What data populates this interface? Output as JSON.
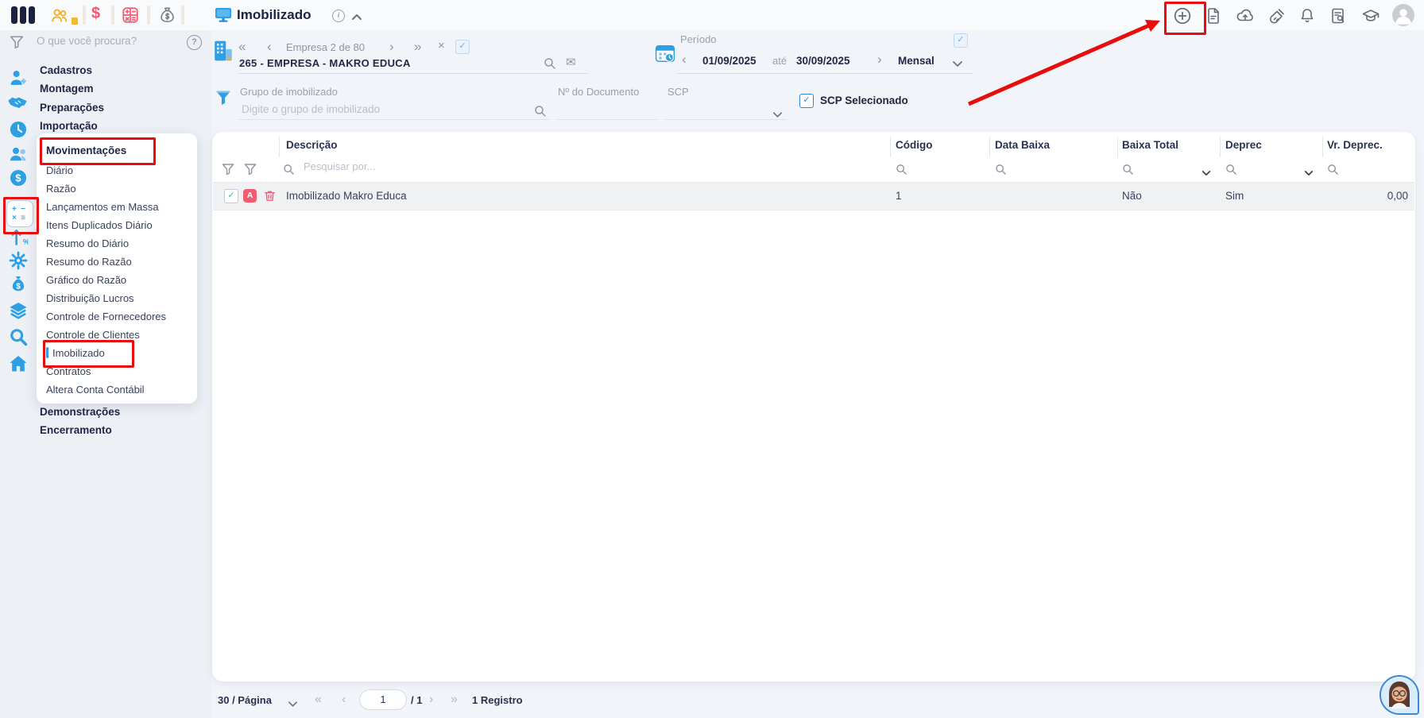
{
  "colors": {
    "accent_blue": "#2D9FE3",
    "navy": "#1E2547",
    "annotation_red": "#E80C0C",
    "badge_red": "#F25C72",
    "check_green": "#3DBD8F",
    "icon_gray": "#656C77",
    "sidebar_bg": "#EDF1F6",
    "card_bg": "#FFFFFF",
    "row_bg": "#F0F1F3"
  },
  "icons": {
    "double_chevron_left": "«",
    "chevron_left": "‹",
    "chevron_right": "›",
    "double_chevron_right": "»",
    "close": "×",
    "question_mark": "?",
    "info": "i",
    "check": "✓",
    "envelope": "✉",
    "dollar": "$",
    "chevron_up": "⌃"
  },
  "topbar": {
    "page_title": "Imobilizado",
    "quick_icons": [
      "people",
      "dollar",
      "calculator",
      "money-bag"
    ],
    "right_icons": [
      "add",
      "document",
      "upload",
      "clean",
      "notifications",
      "audit-log",
      "training",
      "avatar"
    ]
  },
  "sidebar": {
    "search_placeholder": "O que você procura?",
    "rail_icons": [
      "person-gear",
      "handshake",
      "clock",
      "people",
      "dollar",
      "calculator",
      "trending-percent",
      "gear",
      "money-bag",
      "layers",
      "search",
      "home"
    ],
    "menu_top": [
      "Cadastros",
      "Montagem",
      "Preparações",
      "Importação"
    ],
    "submenu_title": "Movimentações",
    "submenu_items": [
      "Diário",
      "Razão",
      "Lançamentos em Massa",
      "Itens Duplicados Diário",
      "Resumo do Diário",
      "Resumo do Razão",
      "Gráfico do Razão",
      "Distribuição Lucros",
      "Controle de Fornecedores",
      "Controle de Clientes",
      "Imobilizado",
      "Contratos",
      "Altera Conta Contábil"
    ],
    "menu_bottom": [
      "Demonstrações",
      "Encerramento"
    ]
  },
  "company": {
    "nav_label": "Empresa 2 de 80",
    "name": "265 - EMPRESA - MAKRO EDUCA"
  },
  "period": {
    "label": "Período",
    "start_date": "01/09/2025",
    "until_label": "até",
    "end_date": "30/09/2025",
    "mode": "Mensal"
  },
  "filters": {
    "grupo_label": "Grupo de imobilizado",
    "grupo_placeholder": "Digite o grupo de imobilizado",
    "documento_label": "Nº do Documento",
    "scp_label": "SCP",
    "scp_selecionado_label": "SCP Selecionado"
  },
  "table": {
    "columns": [
      "Descrição",
      "Código",
      "Data Baixa",
      "Baixa Total",
      "Deprec",
      "Vr. Deprec."
    ],
    "search_placeholder": "Pesquisar por...",
    "rows": [
      {
        "badge": "A",
        "descricao": "Imobilizado Makro Educa",
        "codigo": "1",
        "data_baixa": "",
        "baixa_total": "Não",
        "deprec": "Sim",
        "vr_deprec": "0,00"
      }
    ]
  },
  "pagination": {
    "per_page": "30 / Página",
    "page": "1",
    "total_pages": "/ 1",
    "total_label": "1 Registro"
  }
}
